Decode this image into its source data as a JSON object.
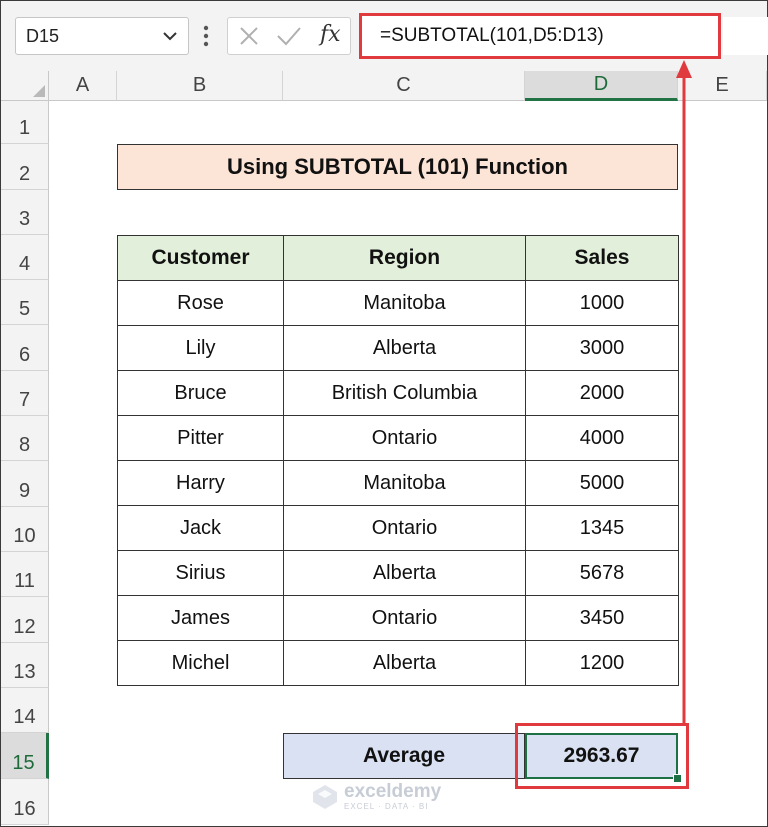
{
  "formula_bar": {
    "name_box": "D15",
    "fx_label": "fx",
    "formula": "=SUBTOTAL(101,D5:D13)"
  },
  "columns": [
    "A",
    "B",
    "C",
    "D",
    "E"
  ],
  "selected_column": "D",
  "rows": [
    "1",
    "2",
    "3",
    "4",
    "5",
    "6",
    "7",
    "8",
    "9",
    "10",
    "11",
    "12",
    "13",
    "14",
    "15",
    "16"
  ],
  "selected_row": "15",
  "sheet": {
    "title": "Using SUBTOTAL (101)  Function",
    "table": {
      "headers": [
        "Customer",
        "Region",
        "Sales"
      ],
      "rows": [
        [
          "Rose",
          "Manitoba",
          "1000"
        ],
        [
          "Lily",
          "Alberta",
          "3000"
        ],
        [
          "Bruce",
          "British Columbia",
          "2000"
        ],
        [
          "Pitter",
          "Ontario",
          "4000"
        ],
        [
          "Harry",
          "Manitoba",
          "5000"
        ],
        [
          "Jack",
          "Ontario",
          "1345"
        ],
        [
          "Sirius",
          "Alberta",
          "5678"
        ],
        [
          "James",
          "Ontario",
          "3450"
        ],
        [
          "Michel",
          "Alberta",
          "1200"
        ]
      ]
    },
    "summary_label": "Average",
    "summary_value": "2963.67"
  },
  "watermark": {
    "name": "exceldemy",
    "tagline": "EXCEL · DATA · BI"
  },
  "colors": {
    "title_fill": "#fce4d6",
    "header_fill": "#e2efda",
    "summary_fill": "#d9e1f2",
    "highlight": "#e0393e",
    "selection": "#217346"
  }
}
